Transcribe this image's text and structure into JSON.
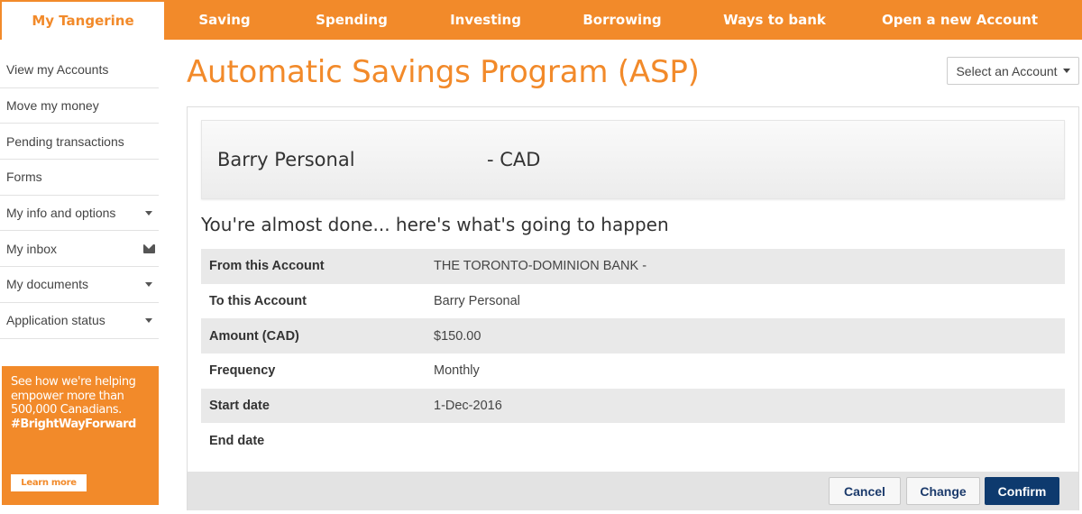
{
  "nav": {
    "tabs": [
      {
        "label": "My Tangerine"
      },
      {
        "label": "Saving"
      },
      {
        "label": "Spending"
      },
      {
        "label": "Investing"
      },
      {
        "label": "Borrowing"
      },
      {
        "label": "Ways to bank"
      },
      {
        "label": "Open a new Account"
      }
    ]
  },
  "sidebar": {
    "items": [
      {
        "label": "View my Accounts"
      },
      {
        "label": "Move my money"
      },
      {
        "label": "Pending transactions"
      },
      {
        "label": "Forms"
      },
      {
        "label": "My info and options"
      },
      {
        "label": "My inbox"
      },
      {
        "label": "My documents"
      },
      {
        "label": "Application status"
      }
    ],
    "promo": {
      "text": "See how we're helping empower more than 500,000 Canadians.",
      "tag": "#BrightWayForward",
      "button": "Learn more"
    }
  },
  "main": {
    "title": "Automatic Savings Program (ASP)",
    "select_account": "Select an Account",
    "account_name": "Barry Personal",
    "account_currency": "- CAD",
    "subtitle": "You're almost done... here's what's going to happen",
    "details": [
      {
        "label": "From this Account",
        "value": "THE TORONTO-DOMINION BANK -"
      },
      {
        "label": "To this Account",
        "value": "Barry Personal"
      },
      {
        "label": "Amount (CAD)",
        "value": "$150.00"
      },
      {
        "label": "Frequency",
        "value": "Monthly"
      },
      {
        "label": "Start date",
        "value": "1-Dec-2016"
      },
      {
        "label": "End date",
        "value": ""
      }
    ],
    "buttons": {
      "cancel": "Cancel",
      "change": "Change",
      "confirm": "Confirm"
    }
  },
  "colors": {
    "brand_orange": "#f28a2a",
    "confirm_navy": "#0e3a6e"
  }
}
